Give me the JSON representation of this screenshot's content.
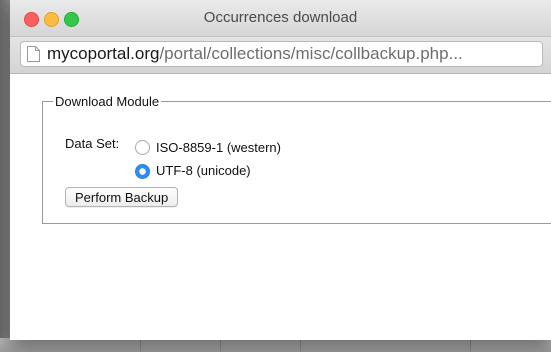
{
  "window": {
    "title": "Occurrences download"
  },
  "urlbar": {
    "host": "mycoportal.org",
    "path": "/portal/collections/misc/collbackup.php..."
  },
  "module": {
    "legend": "Download Module",
    "data_set_label": "Data Set:",
    "options": [
      {
        "label": "ISO-8859-1 (western)",
        "selected": false
      },
      {
        "label": "UTF-8 (unicode)",
        "selected": true
      }
    ],
    "button_label": "Perform Backup"
  },
  "colors": {
    "close": "#fc605c",
    "minimize": "#fdbc40",
    "maximize": "#34c84a",
    "radio_selected": "#2d8cf6"
  }
}
